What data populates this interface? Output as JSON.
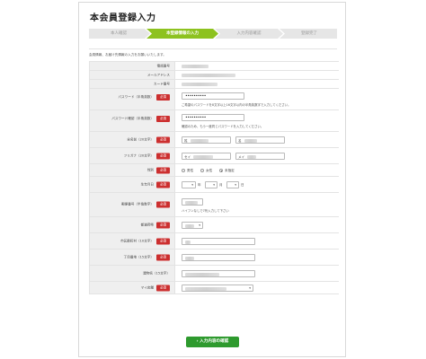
{
  "page_title": "本会員登録入力",
  "steps": [
    {
      "label": "本人確認",
      "state": "done"
    },
    {
      "label": "本登録情報の入力",
      "state": "active"
    },
    {
      "label": "入力内容確認",
      "state": "todo"
    },
    {
      "label": "登録完了",
      "state": "todo"
    }
  ],
  "colors": {
    "active_step": "#8dc21f",
    "inactive_step": "#e6e6e6",
    "required_badge": "#cc2f2f",
    "confirm_button": "#2e9a2e"
  },
  "intro_text": "会員情報、お届け先情報の入力をお願いいたします。",
  "required_label": "必須",
  "form": {
    "phone_label": "電話番号",
    "email_label": "メールアドレス",
    "card_label": "カード番号",
    "password_label": "パスワード（半角英数）",
    "password_value": "••••••••••",
    "password_hint": "ご希望のパスワードを8文字以上16文字以内の半角英数字で入力してください。",
    "password_confirm_label": "パスワード確認（半角英数）",
    "password_confirm_value": "••••••••••",
    "password_confirm_hint": "確認のため、もう一度同じパスワードを入力してください。",
    "name_label": "全名前（20文字）",
    "last_name_prefix": "姓",
    "first_name_prefix": "名",
    "furigana_label": "フリガナ（20文字）",
    "sei_prefix": "セイ",
    "mei_prefix": "メイ",
    "gender_label": "性別",
    "gender_options": [
      "男性",
      "女性",
      "未指定"
    ],
    "birth_label": "生年月日",
    "year_unit": "年",
    "month_unit": "月",
    "day_unit": "日",
    "postal_label": "郵便番号（半角数字）",
    "postal_hint": "ハイフンなしで7桁入力して下さい",
    "prefecture_label": "都道府県",
    "city_label": "市区郡町村（10文字）",
    "street_label": "丁目番地（15文字）",
    "building_label": "建物名（15文字）",
    "store_label": "マイ店舗"
  },
  "confirm_button": "入力内容の確認",
  "confirm_arrow": "›"
}
